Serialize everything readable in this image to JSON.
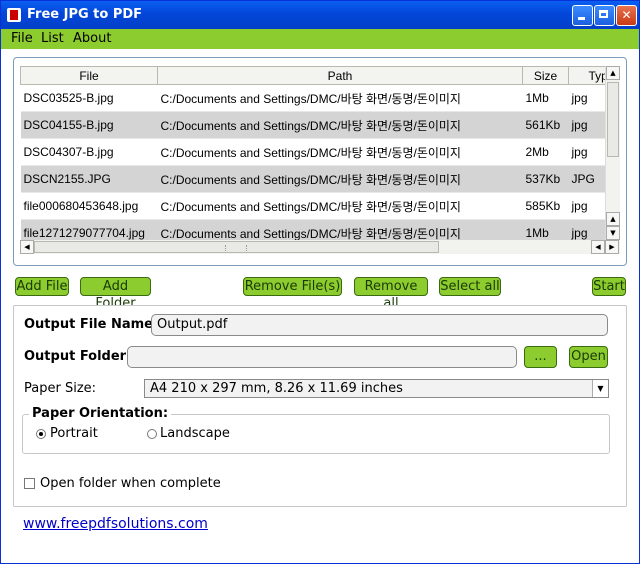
{
  "window": {
    "title": "Free JPG to PDF"
  },
  "menu": [
    "File",
    "List",
    "About"
  ],
  "file_list": {
    "columns": [
      "File",
      "Path",
      "Size",
      "Type"
    ],
    "rows": [
      {
        "file": "DSC03525-B.jpg",
        "path": "C:/Documents and Settings/DMC/바탕 화면/동명/돈이미지",
        "size": "1Mb",
        "type": "jpg"
      },
      {
        "file": "DSC04155-B.jpg",
        "path": "C:/Documents and Settings/DMC/바탕 화면/동명/돈이미지",
        "size": "561Kb",
        "type": "jpg"
      },
      {
        "file": "DSC04307-B.jpg",
        "path": "C:/Documents and Settings/DMC/바탕 화면/동명/돈이미지",
        "size": "2Mb",
        "type": "jpg"
      },
      {
        "file": "DSCN2155.JPG",
        "path": "C:/Documents and Settings/DMC/바탕 화면/동명/돈이미지",
        "size": "537Kb",
        "type": "JPG"
      },
      {
        "file": "file000680453648.jpg",
        "path": "C:/Documents and Settings/DMC/바탕 화면/동명/돈이미지",
        "size": "585Kb",
        "type": "jpg"
      },
      {
        "file": "file1271279077704.jpg",
        "path": "C:/Documents and Settings/DMC/바탕 화면/동명/돈이미지",
        "size": "1Mb",
        "type": "jpg"
      }
    ]
  },
  "buttons": {
    "add_file": "Add File",
    "add_folder": "Add Folder",
    "remove_files": "Remove File(s)",
    "remove_all": "Remove all",
    "select_all": "Select all",
    "start": "Start",
    "browse": "...",
    "open": "Open"
  },
  "settings": {
    "output_file_label": "Output File Name:",
    "output_file_value": "Output.pdf",
    "output_folder_label": "Output Folder:",
    "output_folder_value": "",
    "paper_size_label": "Paper Size:",
    "paper_size_value": "A4 210 x 297 mm, 8.26 x 11.69 inches",
    "orientation_label": "Paper Orientation:",
    "portrait": "Portrait",
    "landscape": "Landscape",
    "portrait_selected": true,
    "open_folder_label": "Open folder when complete",
    "open_folder_checked": false
  },
  "footer": {
    "link": "www.freepdfsolutions.com"
  },
  "colors": {
    "accent_green": "#8ccc2e",
    "titlebar_blue": "#0346d8",
    "link_blue": "#0000cc"
  }
}
